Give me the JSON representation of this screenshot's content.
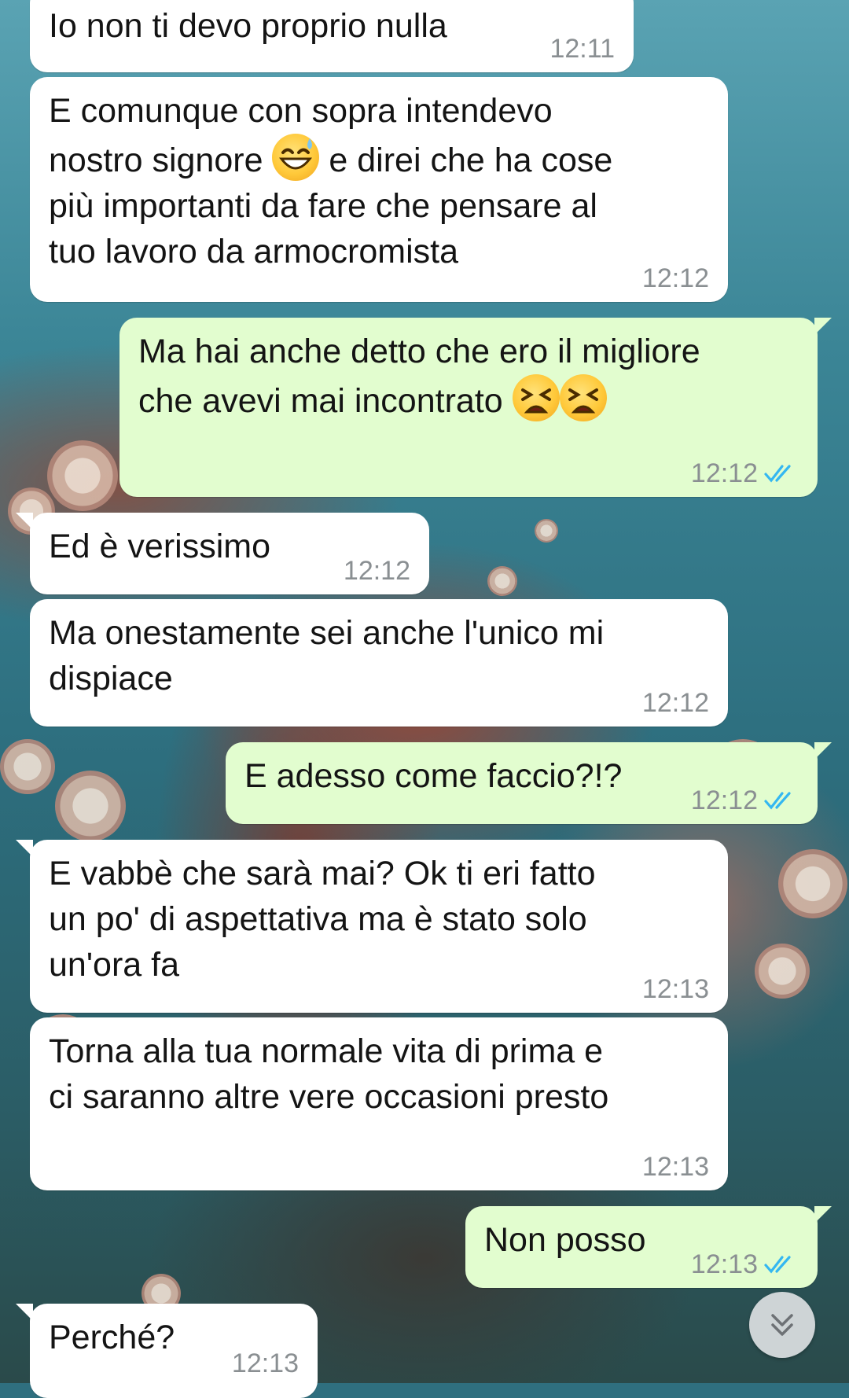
{
  "chat": {
    "messages": [
      {
        "id": "m1",
        "direction": "incoming",
        "text": "Io non ti devo proprio nulla",
        "time": "12:11"
      },
      {
        "id": "m2",
        "direction": "incoming",
        "text_parts": [
          "E comunque con sopra intendevo\nnostro signore ",
          " e direi che ha cose\npiù importanti da fare che pensare al\ntuo lavoro da armocromista"
        ],
        "emoji": [
          "grinning-sweat-emoji"
        ],
        "time": "12:12"
      },
      {
        "id": "m3",
        "direction": "outgoing",
        "text": "Ma hai anche detto che ero il migliore\nche avevi mai incontrato ",
        "emoji": [
          "tired-face-emoji",
          "tired-face-emoji"
        ],
        "time": "12:12",
        "status": "read"
      },
      {
        "id": "m4",
        "direction": "incoming",
        "text": "Ed è verissimo",
        "time": "12:12"
      },
      {
        "id": "m5",
        "direction": "incoming",
        "text": "Ma onestamente sei anche l'unico mi\ndispiace",
        "time": "12:12"
      },
      {
        "id": "m6",
        "direction": "outgoing",
        "text": "E adesso come faccio?!?",
        "time": "12:12",
        "status": "read"
      },
      {
        "id": "m7",
        "direction": "incoming",
        "text": "E vabbè che sarà mai? Ok ti eri fatto\nun po' di aspettativa ma è stato solo\nun'ora fa",
        "time": "12:13"
      },
      {
        "id": "m8",
        "direction": "incoming",
        "text": "Torna alla tua normale vita di prima e\nci saranno altre vere occasioni presto",
        "time": "12:13"
      },
      {
        "id": "m9",
        "direction": "outgoing",
        "text": "Non posso",
        "time": "12:13",
        "status": "read"
      },
      {
        "id": "m10",
        "direction": "incoming",
        "text": "Perché?",
        "time": "12:13"
      }
    ]
  },
  "colors": {
    "incoming_bubble": "#ffffff",
    "outgoing_bubble": "#e2fdcf",
    "read_ticks": "#34b7f1",
    "timestamp": "#8a8f92"
  },
  "scroll_button": {
    "icon": "double-chevron-down-icon"
  }
}
